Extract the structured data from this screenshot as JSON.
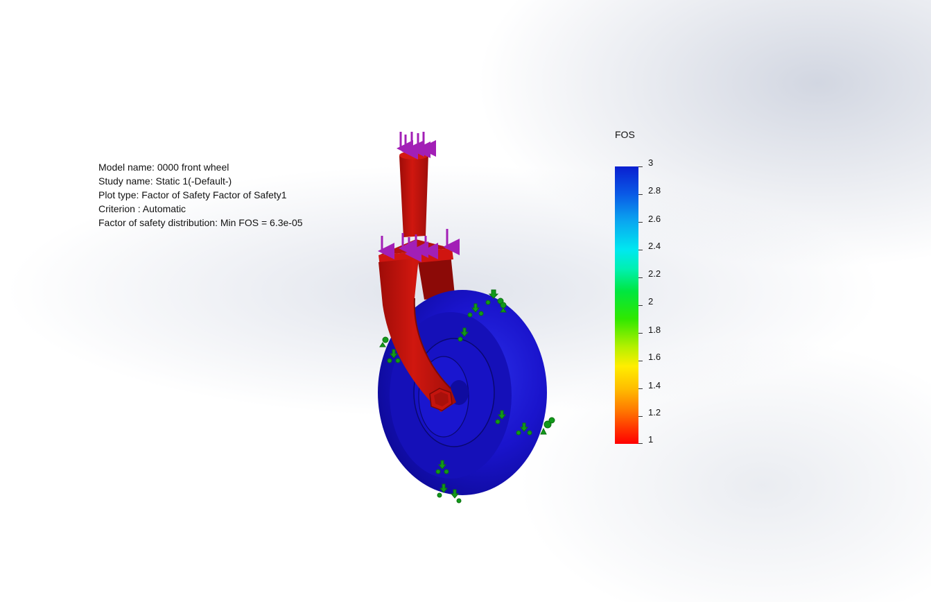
{
  "info": {
    "model_name": "Model name: 0000 front wheel",
    "study_name": "Study name: Static 1(-Default-)",
    "plot_type": "Plot type: Factor of Safety Factor of Safety1",
    "criterion": "Criterion : Automatic",
    "distribution": "Factor of safety distribution: Min FOS = 6.3e-05"
  },
  "legend": {
    "title": "FOS",
    "ticks": [
      "3",
      "2.8",
      "2.6",
      "2.4",
      "2.2",
      "2",
      "1.8",
      "1.6",
      "1.4",
      "1.2",
      "1"
    ],
    "max_color": "#0a1fd0",
    "min_color": "#ff0000"
  },
  "colors": {
    "model_red": "#c0140f",
    "wheel_blue": "#1a12c4",
    "load_arrow": "#a21fb6",
    "fixture_arrow": "#129a1a"
  }
}
